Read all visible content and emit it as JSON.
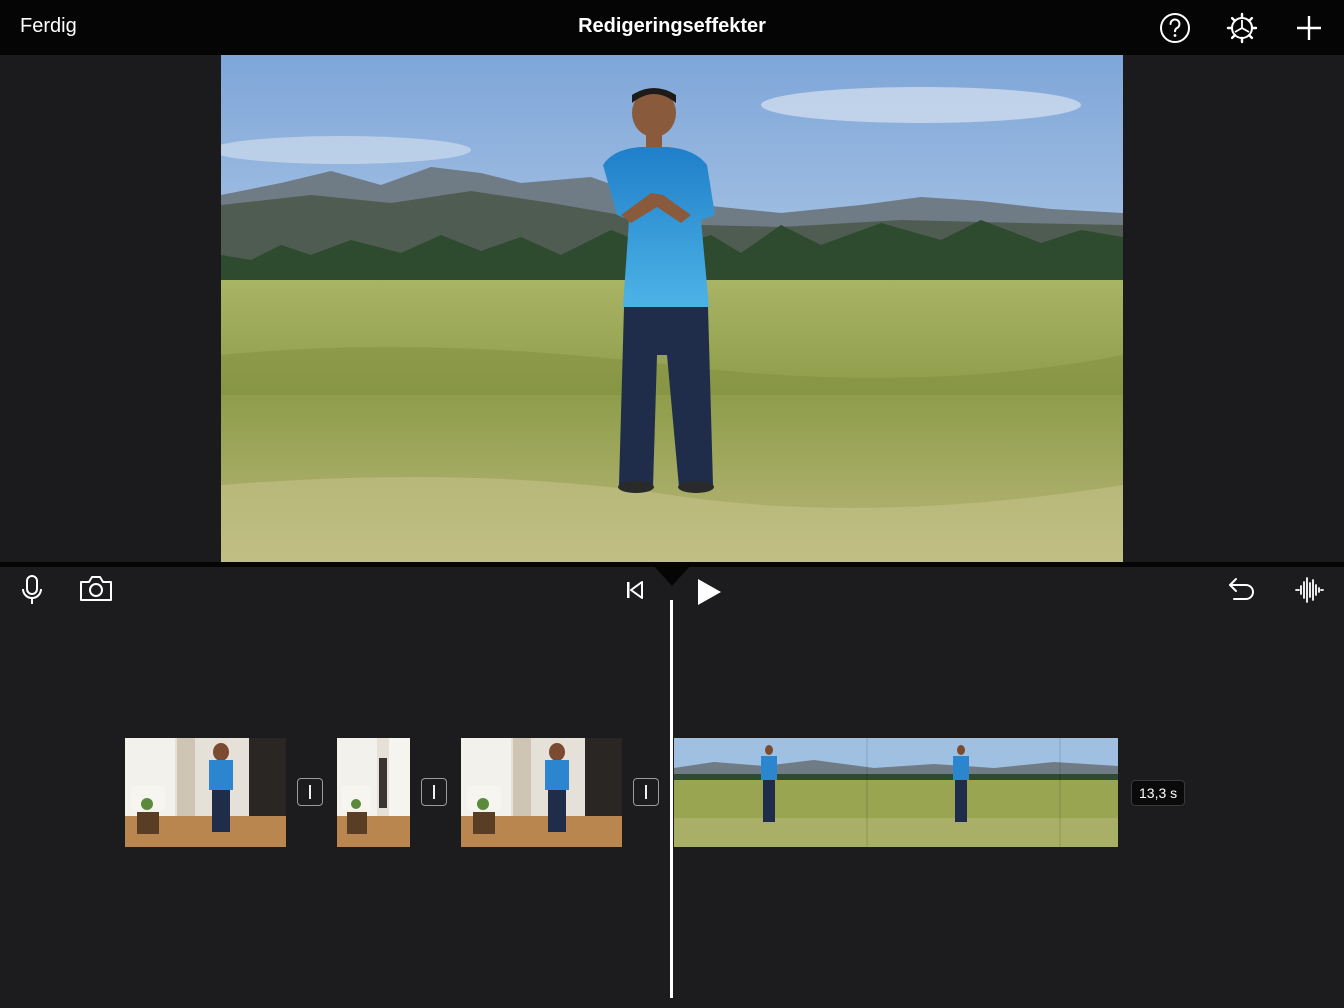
{
  "topbar": {
    "done_label": "Ferdig",
    "title": "Redigeringseffekter",
    "icons": [
      "help-icon",
      "settings-icon",
      "add-icon"
    ]
  },
  "toolbar": {
    "left_icons": [
      "microphone-icon",
      "camera-icon"
    ],
    "center_icons": [
      "skip-to-start-icon",
      "play-icon"
    ],
    "right_icons": [
      "undo-icon",
      "audio-waveform-icon"
    ]
  },
  "timeline": {
    "clips": [
      {
        "scene": "indoor"
      },
      {
        "scene": "indoor"
      },
      {
        "scene": "indoor"
      },
      {
        "scene": "meadow"
      }
    ],
    "transitions": 3,
    "selected_clip_duration": "13,3 s"
  },
  "colors": {
    "background": "#1c1c1e",
    "bar": "#050505",
    "accent": "#ffffff"
  }
}
